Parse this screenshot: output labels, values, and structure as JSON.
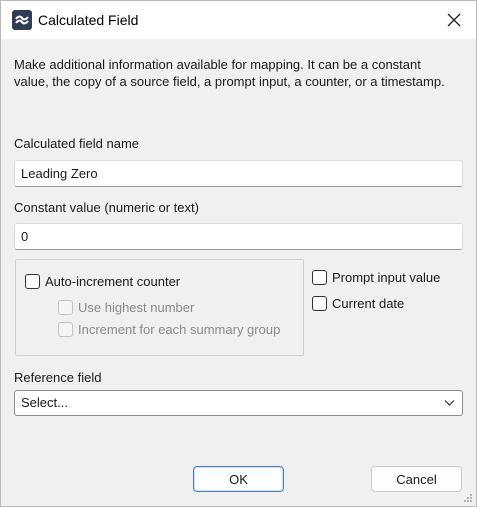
{
  "window": {
    "title": "Calculated Field",
    "icon": "app-logo-icon"
  },
  "description": "Make additional information available for mapping. It can be a constant value, the copy of a source field, a prompt input, a counter, or a timestamp.",
  "fields": {
    "name_label": "Calculated field name",
    "name_value": "Leading Zero",
    "constant_label": "Constant value (numeric or text)",
    "constant_value": "0"
  },
  "options": {
    "auto_increment": "Auto-increment counter",
    "use_highest": "Use highest number",
    "increment_each_group": "Increment for each summary group",
    "prompt_input": "Prompt input value",
    "current_date": "Current date"
  },
  "reference": {
    "label": "Reference field",
    "selected": "Select..."
  },
  "buttons": {
    "ok": "OK",
    "cancel": "Cancel"
  },
  "colors": {
    "dialog_bg": "#f0f0f0",
    "title_bg": "#ffffff",
    "default_button_border": "#4a7fbd"
  }
}
